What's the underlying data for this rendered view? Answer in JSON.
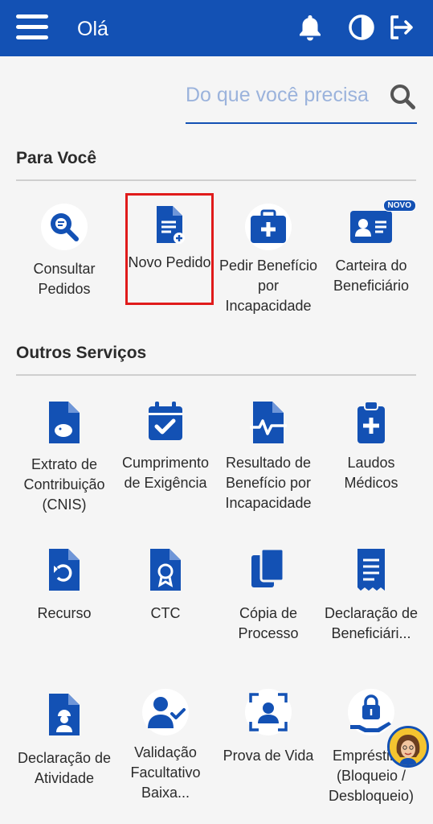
{
  "header": {
    "title": "Olá",
    "menu_icon": "menu-icon",
    "bell_icon": "bell-icon",
    "contrast_icon": "contrast-icon",
    "logout_icon": "logout-icon"
  },
  "search": {
    "placeholder": "Do que você precisa"
  },
  "para_voce": {
    "title": "Para Você",
    "items": [
      {
        "label": "Consultar Pedidos",
        "icon": "search-document-icon"
      },
      {
        "label": "Novo Pedido",
        "icon": "new-document-icon"
      },
      {
        "label": "Pedir Benefício por Incapacidade",
        "icon": "medical-kit-icon"
      },
      {
        "label": "Carteira do Beneficiário",
        "icon": "id-card-icon",
        "badge": "NOVO"
      }
    ]
  },
  "outros_servicos": {
    "title": "Outros Serviços",
    "items": [
      {
        "label": "Extrato de Contribuição (CNIS)",
        "icon": "piggy-bank-document-icon"
      },
      {
        "label": "Cumprimento de Exigência",
        "icon": "calendar-check-icon"
      },
      {
        "label": "Resultado de Benefício por Incapacidade",
        "icon": "pulse-document-icon"
      },
      {
        "label": "Laudos Médicos",
        "icon": "medical-clipboard-icon"
      },
      {
        "label": "Recurso",
        "icon": "undo-document-icon"
      },
      {
        "label": "CTC",
        "icon": "certificate-document-icon"
      },
      {
        "label": "Cópia de Processo",
        "icon": "copy-icon"
      },
      {
        "label": "Declaração de Beneficiári...",
        "icon": "receipt-icon"
      },
      {
        "label": "Declaração de Atividade",
        "icon": "worker-document-icon"
      },
      {
        "label": "Validação Facultativo Baixa...",
        "icon": "user-check-icon"
      },
      {
        "label": "Prova de Vida",
        "icon": "face-scan-icon"
      },
      {
        "label": "Empréstimo (Bloqueio / Desbloqueio)",
        "icon": "lock-hand-icon"
      }
    ]
  },
  "colors": {
    "primary": "#1351b4",
    "highlight": "#e01b1b"
  }
}
